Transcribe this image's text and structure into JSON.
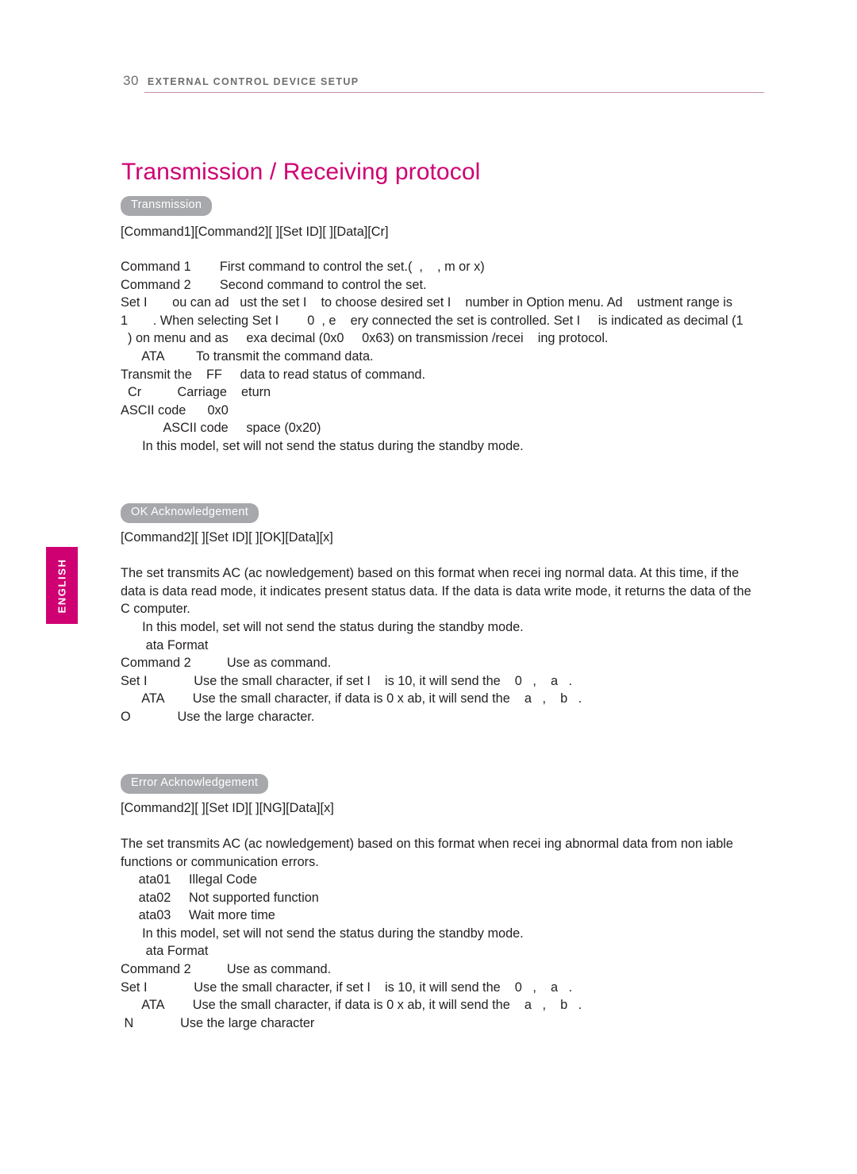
{
  "header": {
    "page_number": "30",
    "section_title": "EXTERNAL CONTROL DEVICE SETUP"
  },
  "language_tab": {
    "label": "ENGLISH"
  },
  "title": "Transmission / Receiving protocol",
  "sections": {
    "transmission": {
      "pill": "Transmission",
      "syntax": "[Command1][Command2][ ][Set ID][ ][Data][Cr]",
      "body": "Command 1        First command to control the set.(  ,    , m or x)\nCommand 2        Second command to control the set.\nSet I       ou can ad   ust the set I    to choose desired set I    number in Option menu. Ad    ustment range is\n1       . When selecting Set I        0  , e    ery connected the set is controlled. Set I     is indicated as decimal (1\n  ) on menu and as     exa decimal (0x0     0x63) on transmission /recei    ing protocol.\n      ATA         To transmit the command data.\nTransmit the    FF     data to read status of command.\n  Cr          Carriage    eturn\nASCII code      0x0\n            ASCII code     space (0x20)\n      In this model, set will not send the status during the standby mode."
    },
    "ok_acknowledgement": {
      "pill": "OK Acknowledgement",
      "syntax": "[Command2][ ][Set ID][ ][OK][Data][x]",
      "paragraph": "The set transmits AC       (ac    nowledgement) based on this format when recei     ing normal data. At this time, if the data is data read mode, it indicates present status data. If the data is data write mode, it returns the data of the    C computer.",
      "body": "      In this model, set will not send the status during the standby mode.\n       ata Format\nCommand 2          Use as command.\nSet I             Use the small character, if set I    is 10, it will send the    0   ,    a   .\n      ATA        Use the small character, if data is 0 x ab, it will send the    a   ,    b   .\nO             Use the large character."
    },
    "error_acknowledgement": {
      "pill": "Error Acknowledgement",
      "syntax": "[Command2][ ][Set ID][ ][NG][Data][x]",
      "paragraph": "The set transmits AC       (ac    nowledgement) based on this format when recei     ing abnormal data from non      iable functions or communication errors.",
      "body": "     ata01     Illegal Code\n     ata02     Not supported function\n     ata03     Wait more time\n      In this model, set will not send the status during the standby mode.\n       ata Format\nCommand 2          Use as command.\nSet I             Use the small character, if set I    is 10, it will send the    0   ,    a   .\n      ATA        Use the small character, if data is 0 x ab, it will send the    a   ,    b   .\n N             Use the large character"
    }
  },
  "colors": {
    "accent": "#cf0072",
    "header_text": "#6d6e71",
    "pill_bg": "#a6a8ab",
    "rule": "#c7909f"
  }
}
